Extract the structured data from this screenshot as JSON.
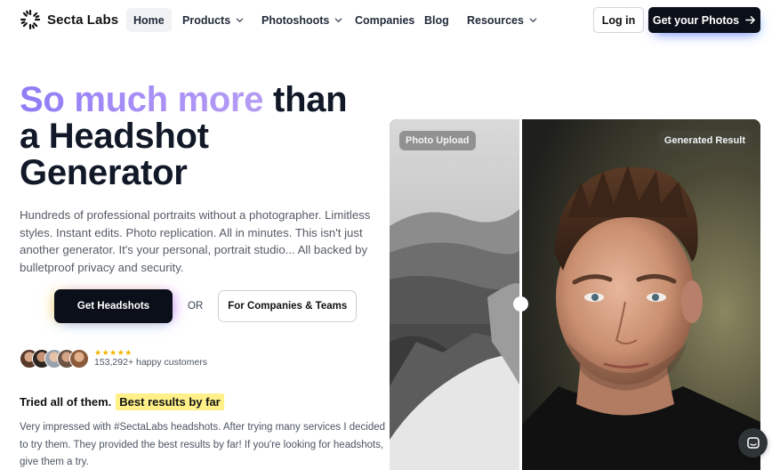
{
  "brand": {
    "name": "Secta Labs"
  },
  "nav": {
    "items": [
      {
        "label": "Home",
        "active": true,
        "has_menu": false
      },
      {
        "label": "Products",
        "active": false,
        "has_menu": true
      },
      {
        "label": "Photoshoots",
        "active": false,
        "has_menu": true
      },
      {
        "label": "Companies",
        "active": false,
        "has_menu": false
      },
      {
        "label": "Blog",
        "active": false,
        "has_menu": false
      },
      {
        "label": "Resources",
        "active": false,
        "has_menu": true
      }
    ],
    "login_label": "Log in",
    "cta_label": "Get your Photos"
  },
  "hero": {
    "title_highlight": "So much more",
    "title_rest_1": " than",
    "title_rest_2": "a Headshot",
    "title_rest_3": "Generator",
    "description": "Hundreds of professional portraits without a photographer. Limitless styles. Instant edits. Photo replication. All in minutes. This isn't just another generator. It's your personal, portrait studio... All backed by bulletproof privacy and security.",
    "primary_cta": "Get Headshots",
    "or_text": "OR",
    "secondary_cta": "For Companies & Teams"
  },
  "social_proof": {
    "stars": "★★★★★",
    "rating": 5,
    "customers_text": "153,292+ happy customers"
  },
  "testimonial": {
    "heading": "Tried all of them.",
    "highlight": "Best results by far",
    "quote": "Very impressed with #SectaLabs headshots. After trying many services I decided to try them. They provided the best results by far! If you're looking for headshots, give them a try."
  },
  "compare": {
    "left_label": "Photo Upload",
    "right_label": "Generated Result"
  },
  "colors": {
    "dark": "#0b0f19",
    "gradient_start": "#8e7cf6",
    "gradient_end": "#b59cf4",
    "highlight": "#fff08a",
    "star": "#f5b301"
  },
  "icons": {
    "logo": "sunburst-logo-icon",
    "chevron": "chevron-down-icon",
    "arrow": "arrow-right-icon",
    "chat": "chat-bubble-icon"
  }
}
